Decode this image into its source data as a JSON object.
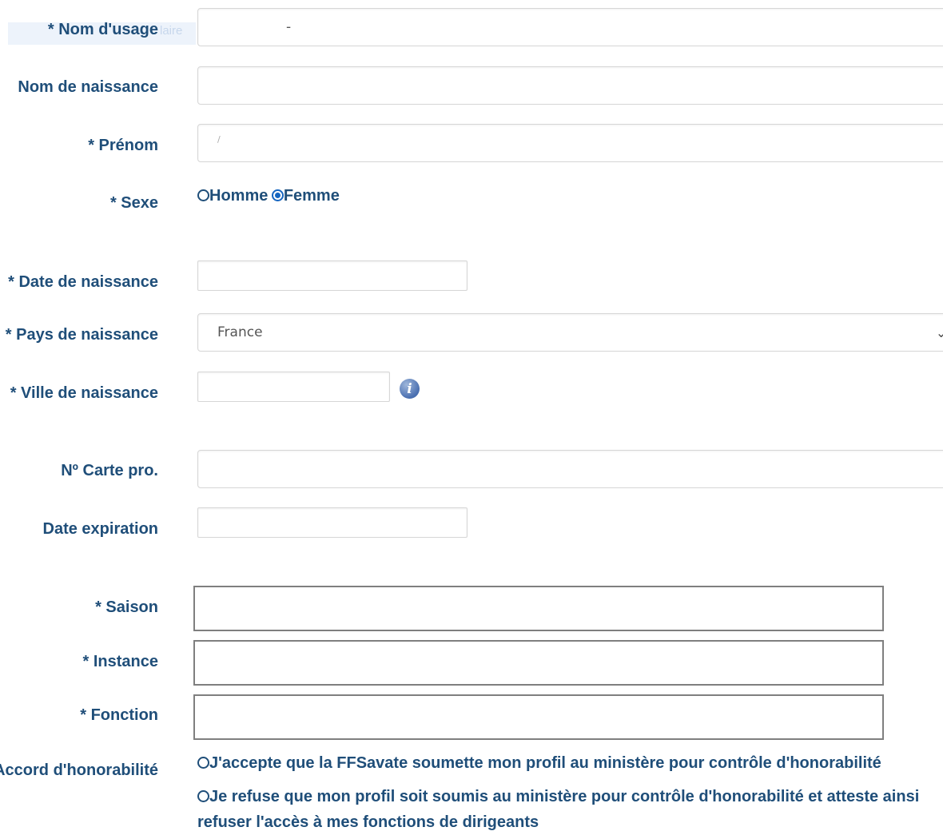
{
  "form": {
    "nom_usage": {
      "label": "* Nom d'usage",
      "value": "-"
    },
    "nom_naissance": {
      "label": "Nom de naissance",
      "value": ""
    },
    "prenom": {
      "label": "* Prénom",
      "value": "/"
    },
    "sexe": {
      "label": "* Sexe",
      "options": [
        "Homme",
        "Femme"
      ],
      "selected": "Femme"
    },
    "date_naissance": {
      "label": "* Date de naissance",
      "value": ""
    },
    "pays_naissance": {
      "label": "* Pays de naissance",
      "value": "France"
    },
    "ville_naissance": {
      "label": "* Ville de naissance",
      "value": ""
    },
    "carte_pro": {
      "label": "Nº Carte pro.",
      "value": ""
    },
    "date_expiration": {
      "label": "Date expiration",
      "value": ""
    },
    "saison": {
      "label": "* Saison",
      "value": ""
    },
    "instance": {
      "label": "* Instance",
      "value": ""
    },
    "fonction": {
      "label": "* Fonction",
      "value": ""
    },
    "honorabilite": {
      "label": "Accord d'honorabilité",
      "option_accept": "J'accepte que la FFSavate soumette mon profil au ministère pour contrôle d'honorabilité",
      "option_refuse": "Je refuse que mon profil soit soumis au ministère pour contrôle d'honorabilité et atteste ainsi refuser l'accès à mes fonctions de dirigeants"
    }
  },
  "icons": {
    "info": "info-icon",
    "dropdown": "chevron-down-icon"
  },
  "colors": {
    "label": "#1f4e79",
    "radio_checked": "#1565c0",
    "info_icon": "#4a6fb0"
  }
}
